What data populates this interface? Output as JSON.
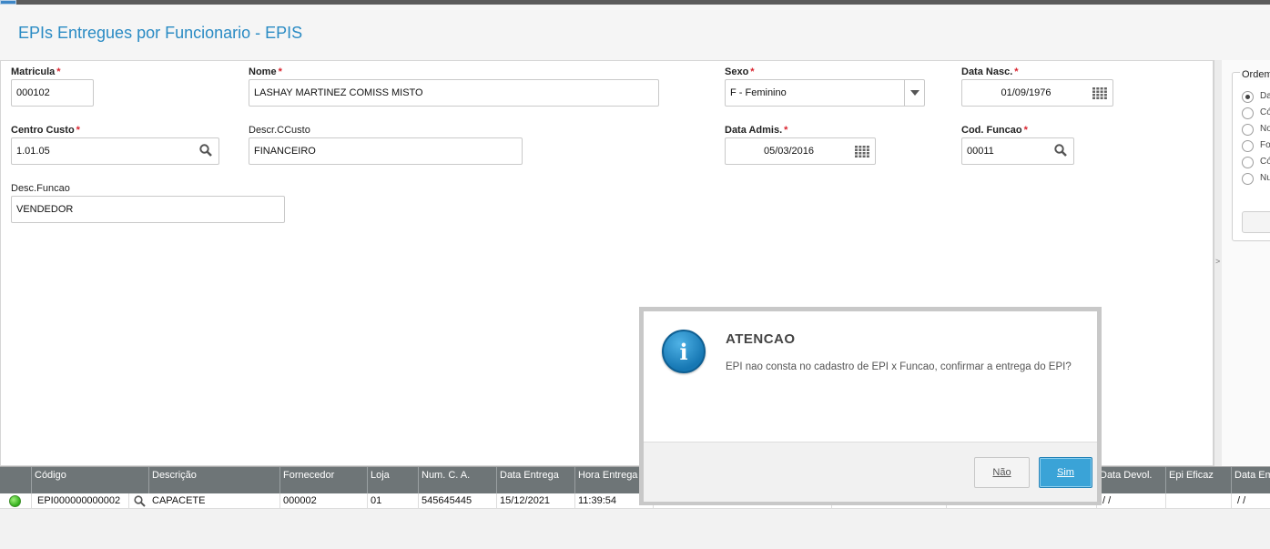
{
  "header": {
    "title": "EPIs Entregues por Funcionario - EPIS"
  },
  "form": {
    "matricula": {
      "label": "Matricula",
      "required": "*",
      "value": "000102"
    },
    "nome": {
      "label": "Nome",
      "required": "*",
      "value": "LASHAY MARTINEZ COMISS MISTO"
    },
    "sexo": {
      "label": "Sexo",
      "required": "*",
      "value": "F - Feminino"
    },
    "data_nasc": {
      "label": "Data Nasc.",
      "required": "*",
      "value": "01/09/1976"
    },
    "centro_custo": {
      "label": "Centro Custo",
      "required": "*",
      "value": "1.01.05"
    },
    "descr_ccusto": {
      "label": "Descr.CCusto",
      "value": "FINANCEIRO"
    },
    "data_admis": {
      "label": "Data Admis.",
      "required": "*",
      "value": "05/03/2016"
    },
    "cod_funcao": {
      "label": "Cod. Funcao",
      "required": "*",
      "value": "00011"
    },
    "desc_funcao": {
      "label": "Desc.Funcao",
      "value": "VENDEDOR"
    }
  },
  "side_panel": {
    "legend": "Ordem",
    "options": [
      "Da",
      "Có",
      "No",
      "Fo",
      "Có",
      "Nu"
    ],
    "selected_index": 0,
    "collapse_glyph": ">"
  },
  "grid": {
    "columns": [
      "Código",
      "Descrição",
      "Fornecedor",
      "Loja",
      "Num. C. A.",
      "Data Entrega",
      "Hora Entrega",
      "Data Devol.",
      "Epi Eficaz",
      "Data Em"
    ],
    "rows": [
      {
        "codigo": "EPI000000000002",
        "descricao": "CAPACETE",
        "fornecedor": "000002",
        "loja": "01",
        "num_ca": "545645445",
        "data_entrega": "15/12/2021",
        "hora_entrega": "11:39:54",
        "data_devol": " / /",
        "epi_eficaz": "",
        "data_em": " / /"
      }
    ]
  },
  "dialog": {
    "title": "ATENCAO",
    "message": "EPI nao consta no cadastro de EPI x Funcao, confirmar a entrega do EPI?",
    "no_label": "Não",
    "yes_label": "Sim",
    "icon_glyph": "i"
  },
  "colors": {
    "title_blue": "#2a8bc4",
    "required_red": "#d9232e",
    "grid_header": "#6e7577",
    "primary_button": "#3aa3d7"
  }
}
